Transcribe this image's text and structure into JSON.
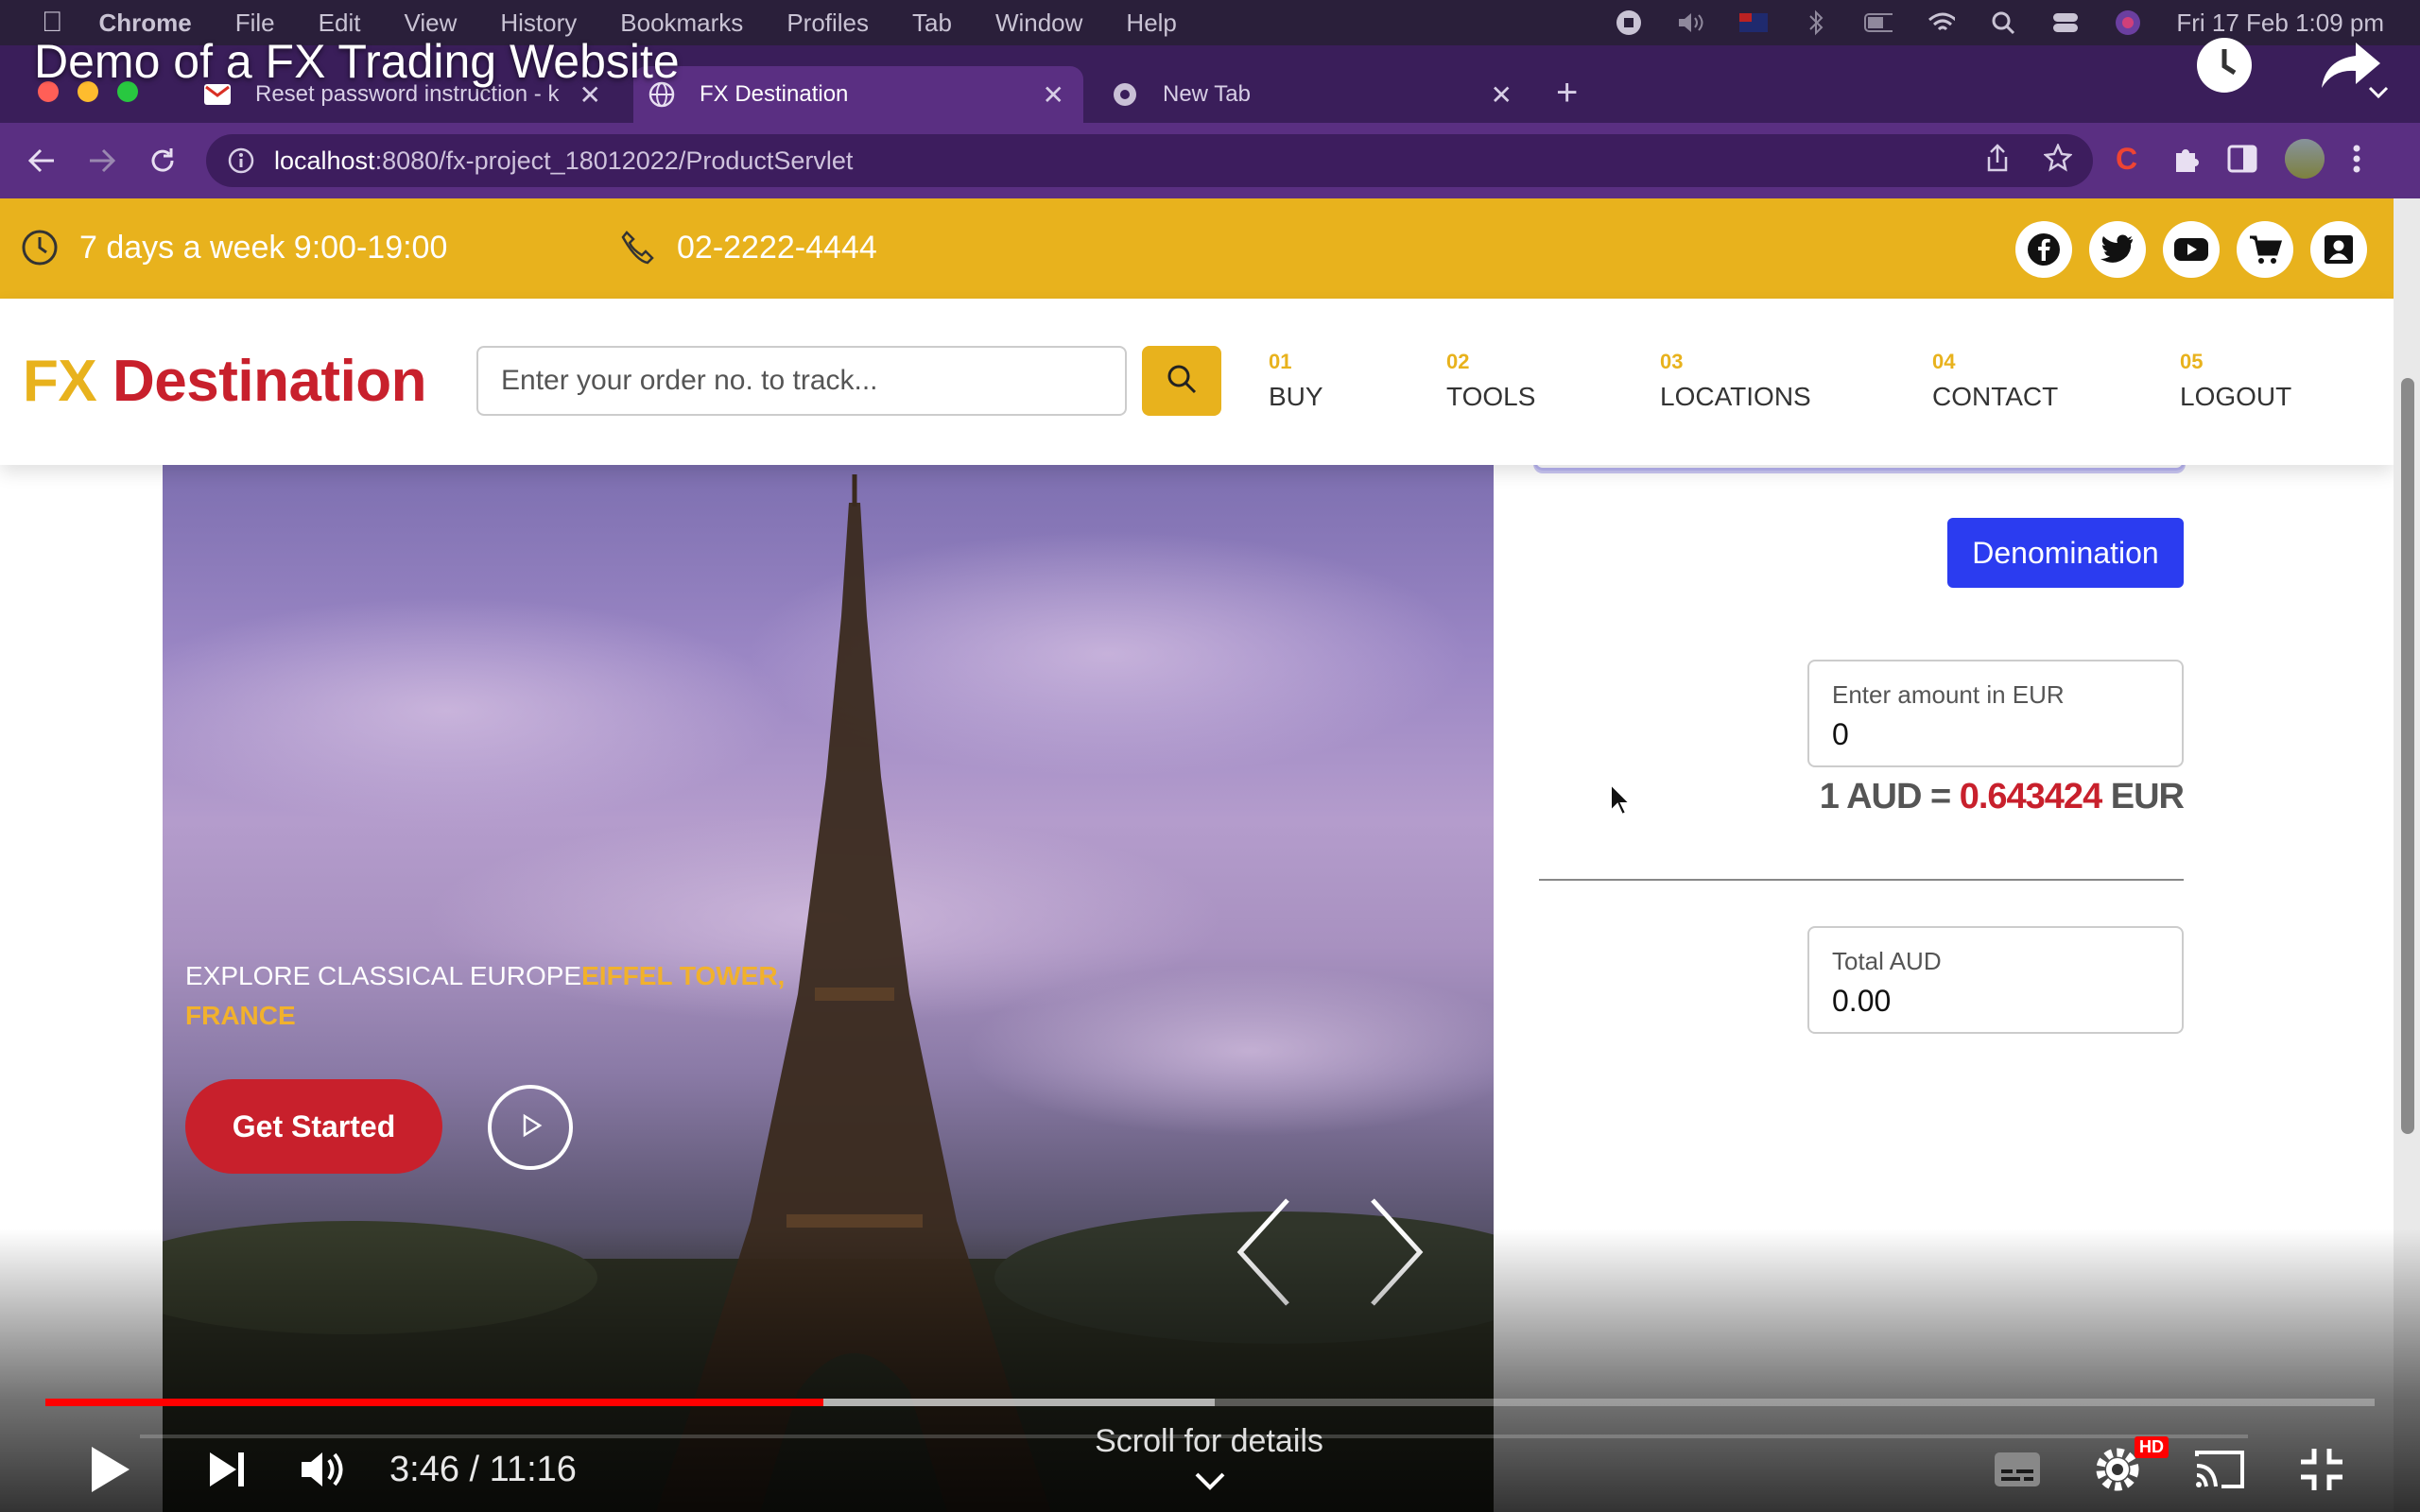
{
  "menubar": {
    "app_name": "Chrome",
    "items": [
      "File",
      "Edit",
      "View",
      "History",
      "Bookmarks",
      "Profiles",
      "Tab",
      "Window",
      "Help"
    ],
    "clock": "Fri 17 Feb  1:09 pm"
  },
  "video": {
    "title": "Demo of a FX Trading Website",
    "current_time": "3:46",
    "duration": "11:16",
    "time_display": "3:46 / 11:16",
    "played_fraction": 0.334,
    "buffered_fraction": 0.502,
    "scroll_hint": "Scroll for details",
    "hd_badge": "HD"
  },
  "browser": {
    "tabs": [
      {
        "label": "Reset password instruction - k",
        "icon": "gmail-icon",
        "active": false
      },
      {
        "label": "FX Destination",
        "icon": "globe-icon",
        "active": true
      },
      {
        "label": "New Tab",
        "icon": "chrome-icon",
        "active": false
      }
    ],
    "url_host": "localhost",
    "url_path": ":8080/fx-project_18012022/ProductServlet"
  },
  "site": {
    "topbar": {
      "hours": "7 days a week 9:00-19:00",
      "phone": "02-2222-4444",
      "social_icons": [
        "facebook-icon",
        "twitter-icon",
        "youtube-icon",
        "cart-icon",
        "account-icon"
      ]
    },
    "logo": {
      "part1": "FX",
      "part2": "Destination"
    },
    "search": {
      "placeholder": "Enter your order no. to track..."
    },
    "nav": [
      {
        "num": "01",
        "label": "BUY"
      },
      {
        "num": "02",
        "label": "TOOLS"
      },
      {
        "num": "03",
        "label": "LOCATIONS"
      },
      {
        "num": "04",
        "label": "CONTACT"
      },
      {
        "num": "05",
        "label": "LOGOUT"
      }
    ],
    "hero": {
      "caption_main": "EXPLORE CLASSICAL EUROPE",
      "caption_highlight": "EIFFEL TOWER, FRANCE",
      "cta_label": "Get Started"
    },
    "converter": {
      "denomination_label": "Denomination",
      "amount_label": "Enter amount in EUR",
      "amount_value": "0",
      "rate_prefix": "1 AUD =",
      "rate_value": "0.643424",
      "rate_suffix": "EUR",
      "total_label": "Total AUD",
      "total_value": "0.00"
    }
  },
  "colors": {
    "brand_yellow": "#e8b21d",
    "brand_red": "#c8202c",
    "button_blue": "#2b3cf0",
    "chrome_purple": "#5a2f82",
    "yt_red": "#ff0000"
  }
}
